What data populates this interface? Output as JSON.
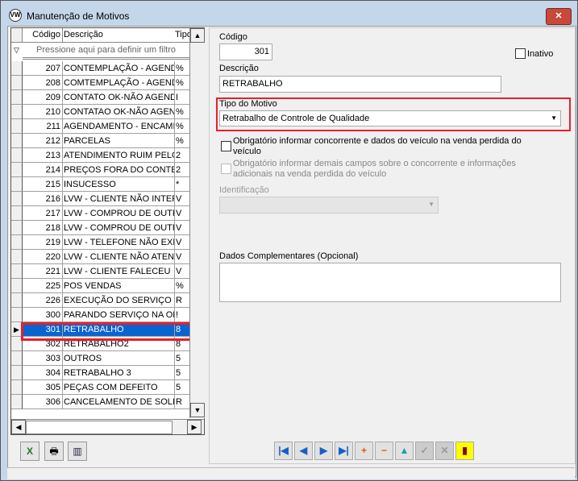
{
  "window": {
    "title": "Manutenção de Motivos",
    "close": "✕"
  },
  "grid": {
    "headers": {
      "codigo": "Código",
      "descricao": "Descrição",
      "tipo": "Tipo"
    },
    "filter_placeholder": "Pressione aqui para definir um filtro",
    "rows": [
      {
        "codigo": "207",
        "descricao": "CONTEMPLAÇÃO - AGENDAMENTO",
        "tipo": "%"
      },
      {
        "codigo": "208",
        "descricao": "COMTEMPLAÇÃO - AGENDAMENTO",
        "tipo": "%"
      },
      {
        "codigo": "209",
        "descricao": "CONTATO OK-NÃO AGENDADO",
        "tipo": "I"
      },
      {
        "codigo": "210",
        "descricao": "CONTATAO OK-NÃO AGENDADO",
        "tipo": "%"
      },
      {
        "codigo": "211",
        "descricao": "AGENDAMENTO - ENCAMINHADO",
        "tipo": "%"
      },
      {
        "codigo": "212",
        "descricao": "PARCELAS",
        "tipo": "%"
      },
      {
        "codigo": "213",
        "descricao": "ATENDIMENTO RUIM PELO VENDEDOR",
        "tipo": "2"
      },
      {
        "codigo": "214",
        "descricao": "PREÇOS FORA DO CONTEXTO",
        "tipo": "2"
      },
      {
        "codigo": "215",
        "descricao": "INSUCESSO",
        "tipo": "*"
      },
      {
        "codigo": "216",
        "descricao": "LVW - CLIENTE NÃO INTERESSADO",
        "tipo": "V"
      },
      {
        "codigo": "217",
        "descricao": "LVW - COMPROU DE OUTRA",
        "tipo": "V"
      },
      {
        "codigo": "218",
        "descricao": "LVW - COMPROU DE OUTRA",
        "tipo": "V"
      },
      {
        "codigo": "219",
        "descricao": "LVW - TELEFONE NÃO EXISTE",
        "tipo": "V"
      },
      {
        "codigo": "220",
        "descricao": "LVW - CLIENTE NÃO ATENDE",
        "tipo": "V"
      },
      {
        "codigo": "221",
        "descricao": "LVW - CLIENTE FALECEU",
        "tipo": "V"
      },
      {
        "codigo": "225",
        "descricao": "POS VENDAS",
        "tipo": "%"
      },
      {
        "codigo": "226",
        "descricao": "EXECUÇÃO DO SERVIÇO EM",
        "tipo": "R"
      },
      {
        "codigo": "300",
        "descricao": "PARANDO SERVIÇO NA OFICINA",
        "tipo": "!"
      },
      {
        "codigo": "301",
        "descricao": "RETRABALHO",
        "tipo": "8"
      },
      {
        "codigo": "302",
        "descricao": "RETRABALHO2",
        "tipo": "8"
      },
      {
        "codigo": "303",
        "descricao": "OUTROS",
        "tipo": "5"
      },
      {
        "codigo": "304",
        "descricao": "RETRABALHO 3",
        "tipo": "5"
      },
      {
        "codigo": "305",
        "descricao": "PEÇAS COM DEFEITO",
        "tipo": "5"
      },
      {
        "codigo": "306",
        "descricao": "CANCELAMENTO DE SOLICITAÇÃO",
        "tipo": "R"
      }
    ],
    "selected_codigo": "301"
  },
  "form": {
    "codigo_label": "Código",
    "codigo_value": "301",
    "inativo_label": "Inativo",
    "descricao_label": "Descrição",
    "descricao_value": "RETRABALHO",
    "tipo_label": "Tipo do Motivo",
    "tipo_value": "Retrabalho de Controle de Qualidade",
    "obrig1": "Obrigatório informar concorrente e dados do veículo na venda perdida do veículo",
    "obrig2": "Obrigatório informar demais campos sobre o concorrente e informações adicionais na venda perdida do veículo",
    "identificacao_label": "Identificação",
    "dados_label": "Dados Complementares (Opcional)"
  },
  "highlight_color": "#e8202a"
}
